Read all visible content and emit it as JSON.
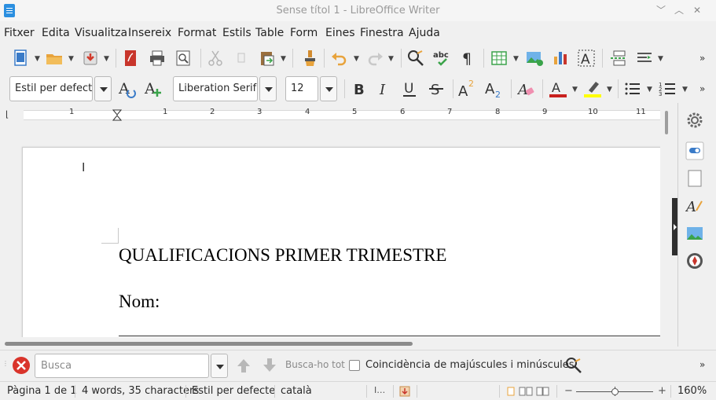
{
  "window": {
    "title": "Sense títol 1 - LibreOffice Writer",
    "minimize_glyph": "﹀",
    "maximize_glyph": "︿",
    "close_glyph": "✕"
  },
  "menu": [
    "Fitxer",
    "Edita",
    "Visualitza",
    "Insereix",
    "Format",
    "Estils",
    "Table",
    "Form",
    "Eines",
    "Finestra",
    "Ajuda"
  ],
  "formatting": {
    "paragraph_style": "Estil per defecte",
    "font_name": "Liberation Serif",
    "font_size": "12"
  },
  "ruler": {
    "numbers": [
      "1",
      "1",
      "2",
      "3",
      "4",
      "5",
      "6",
      "7",
      "8",
      "9",
      "10",
      "11"
    ]
  },
  "document": {
    "heading": "QUALIFICACIONS PRIMER TRIMESTRE",
    "name_label": "Nom:"
  },
  "find": {
    "placeholder": "Busca",
    "find_all": "Busca-ho tot",
    "match_case": "Coincidència de majúscules i minúscules"
  },
  "status": {
    "page": "Pàgina 1 de 1",
    "words": "4 words, 35 characters",
    "style": "Estil per defecte",
    "language": "català",
    "zoom": "160%",
    "zoom_level": 0.5
  },
  "colors": {
    "font_color": "#c9211e",
    "highlight": "#ffff00",
    "accent": "#2b8fe0"
  }
}
